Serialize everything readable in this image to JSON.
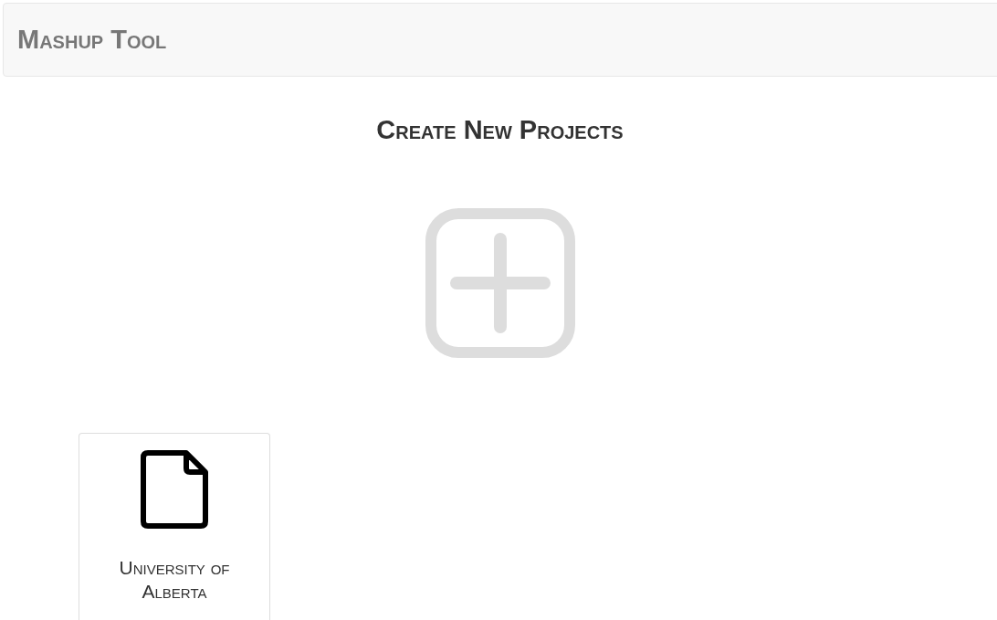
{
  "navbar": {
    "brand": "Mashup Tool"
  },
  "heading": "Create New Projects",
  "projects": [
    {
      "name": "University of Alberta"
    }
  ]
}
